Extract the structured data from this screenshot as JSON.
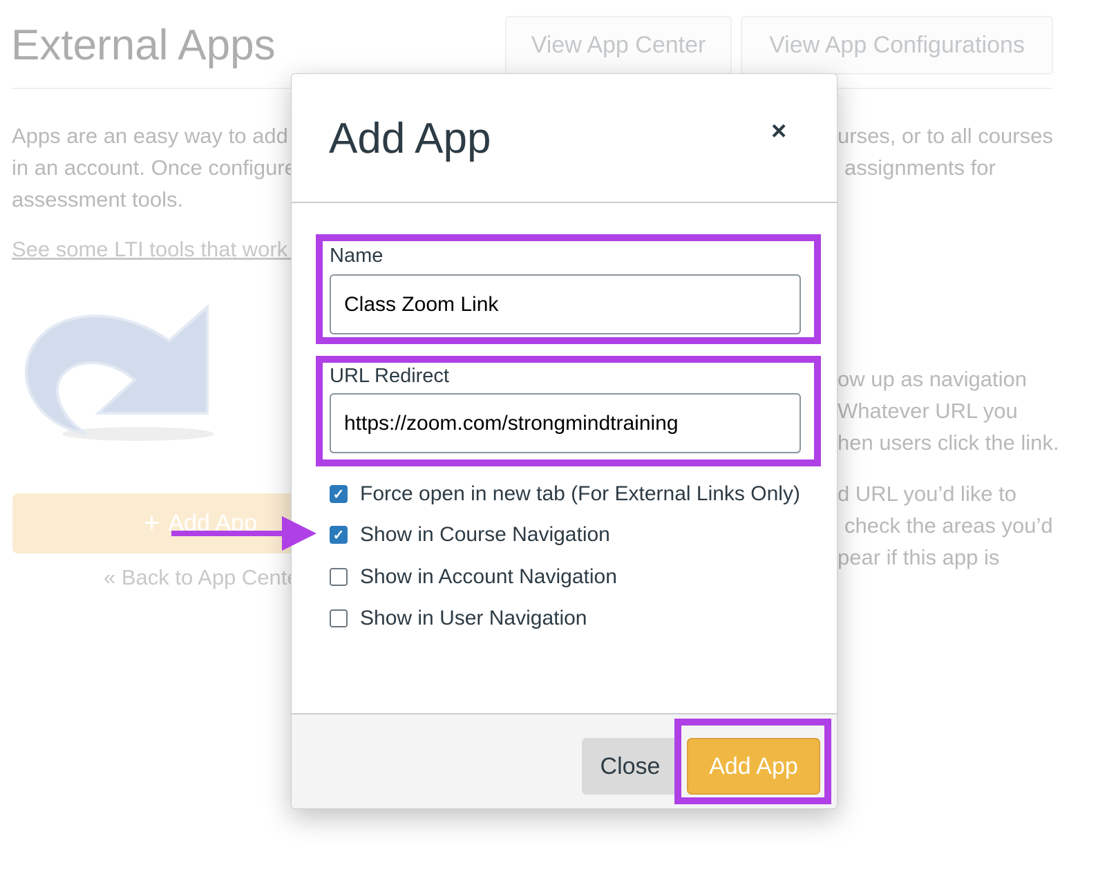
{
  "page": {
    "title": "External Apps",
    "view_app_center": "View App Center",
    "view_app_configurations": "View App Configurations",
    "left_lines": [
      "Apps are an easy way to add r",
      "in an account. Once configure",
      "assessment tools."
    ],
    "right_lines_top": [
      "urses, or to all courses",
      "assignments for"
    ],
    "right_lines_mid": [
      "ow up as navigation",
      "Whatever URL you",
      "hen users click the link."
    ],
    "right_lines_bottom": [
      "d URL you’d like to",
      "check the areas you’d",
      "pear if this app is"
    ],
    "lti_link": "See some LTI tools that work g",
    "add_app_button": "Add App",
    "back_link": "« Back to App Cente"
  },
  "modal": {
    "title": "Add App",
    "close_icon": "×",
    "name_label": "Name",
    "name_value": "Class Zoom Link",
    "url_label": "URL Redirect",
    "url_value": "https://zoom.com/strongmindtraining",
    "options": [
      {
        "label": "Force open in new tab (For External Links Only)",
        "checked": true
      },
      {
        "label": "Show in Course Navigation",
        "checked": true
      },
      {
        "label": "Show in Account Navigation",
        "checked": false
      },
      {
        "label": "Show in User Navigation",
        "checked": false
      }
    ],
    "close_button": "Close",
    "add_button": "Add App"
  },
  "colors": {
    "highlight": "#af40e6",
    "primary": "#f0b843",
    "checkbox": "#2b7abc"
  }
}
